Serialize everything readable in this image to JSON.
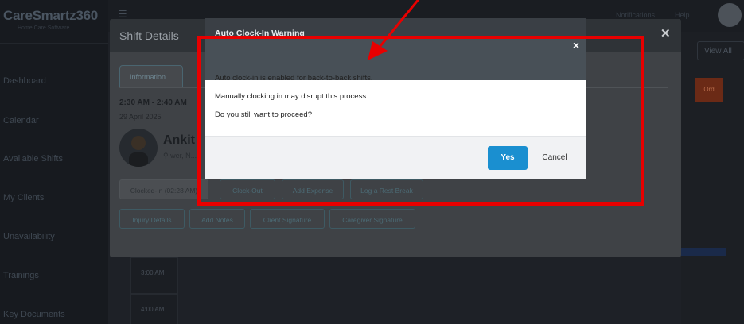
{
  "app": {
    "logo": "CareSmartz360",
    "logo_sub": "Home Care Software",
    "sidebar": {
      "items": [
        {
          "label": "Dashboard"
        },
        {
          "label": "Calendar"
        },
        {
          "label": "Available Shifts"
        },
        {
          "label": "My Clients"
        },
        {
          "label": "Unavailability"
        },
        {
          "label": "Trainings"
        },
        {
          "label": "Key Documents"
        }
      ]
    },
    "topbar": {
      "link1": "Notifications",
      "link2": "Help"
    },
    "view_all": "View All",
    "side_button": "Ord",
    "time_slots": [
      "3:00 AM",
      "4:00 AM"
    ]
  },
  "shift_details": {
    "title": "Shift Details",
    "tab_information": "Information",
    "time": "2:30 AM - 2:40 AM",
    "date": "29 April 2025",
    "client_name": "Ankit",
    "client_location": "wer, N...",
    "buttons_row1": [
      "Clocked-In (02:28 AM)",
      "Clock-Out",
      "Add Expense",
      "Log a Rest Break"
    ],
    "buttons_row2": [
      "Injury Details",
      "Add Notes",
      "Client Signature",
      "Caregiver Signature"
    ]
  },
  "dialog": {
    "title": "Auto Clock-In Warning",
    "close_symbol": "×",
    "lines": [
      "Auto clock-in is enabled for back-to-back shifts.",
      "Manually clocking in may disrupt this process.",
      "Do you still want to proceed?"
    ],
    "yes_label": "Yes",
    "cancel_label": "Cancel"
  },
  "colors": {
    "annotation": "#e80000",
    "primary_button": "#1a8fd0"
  }
}
